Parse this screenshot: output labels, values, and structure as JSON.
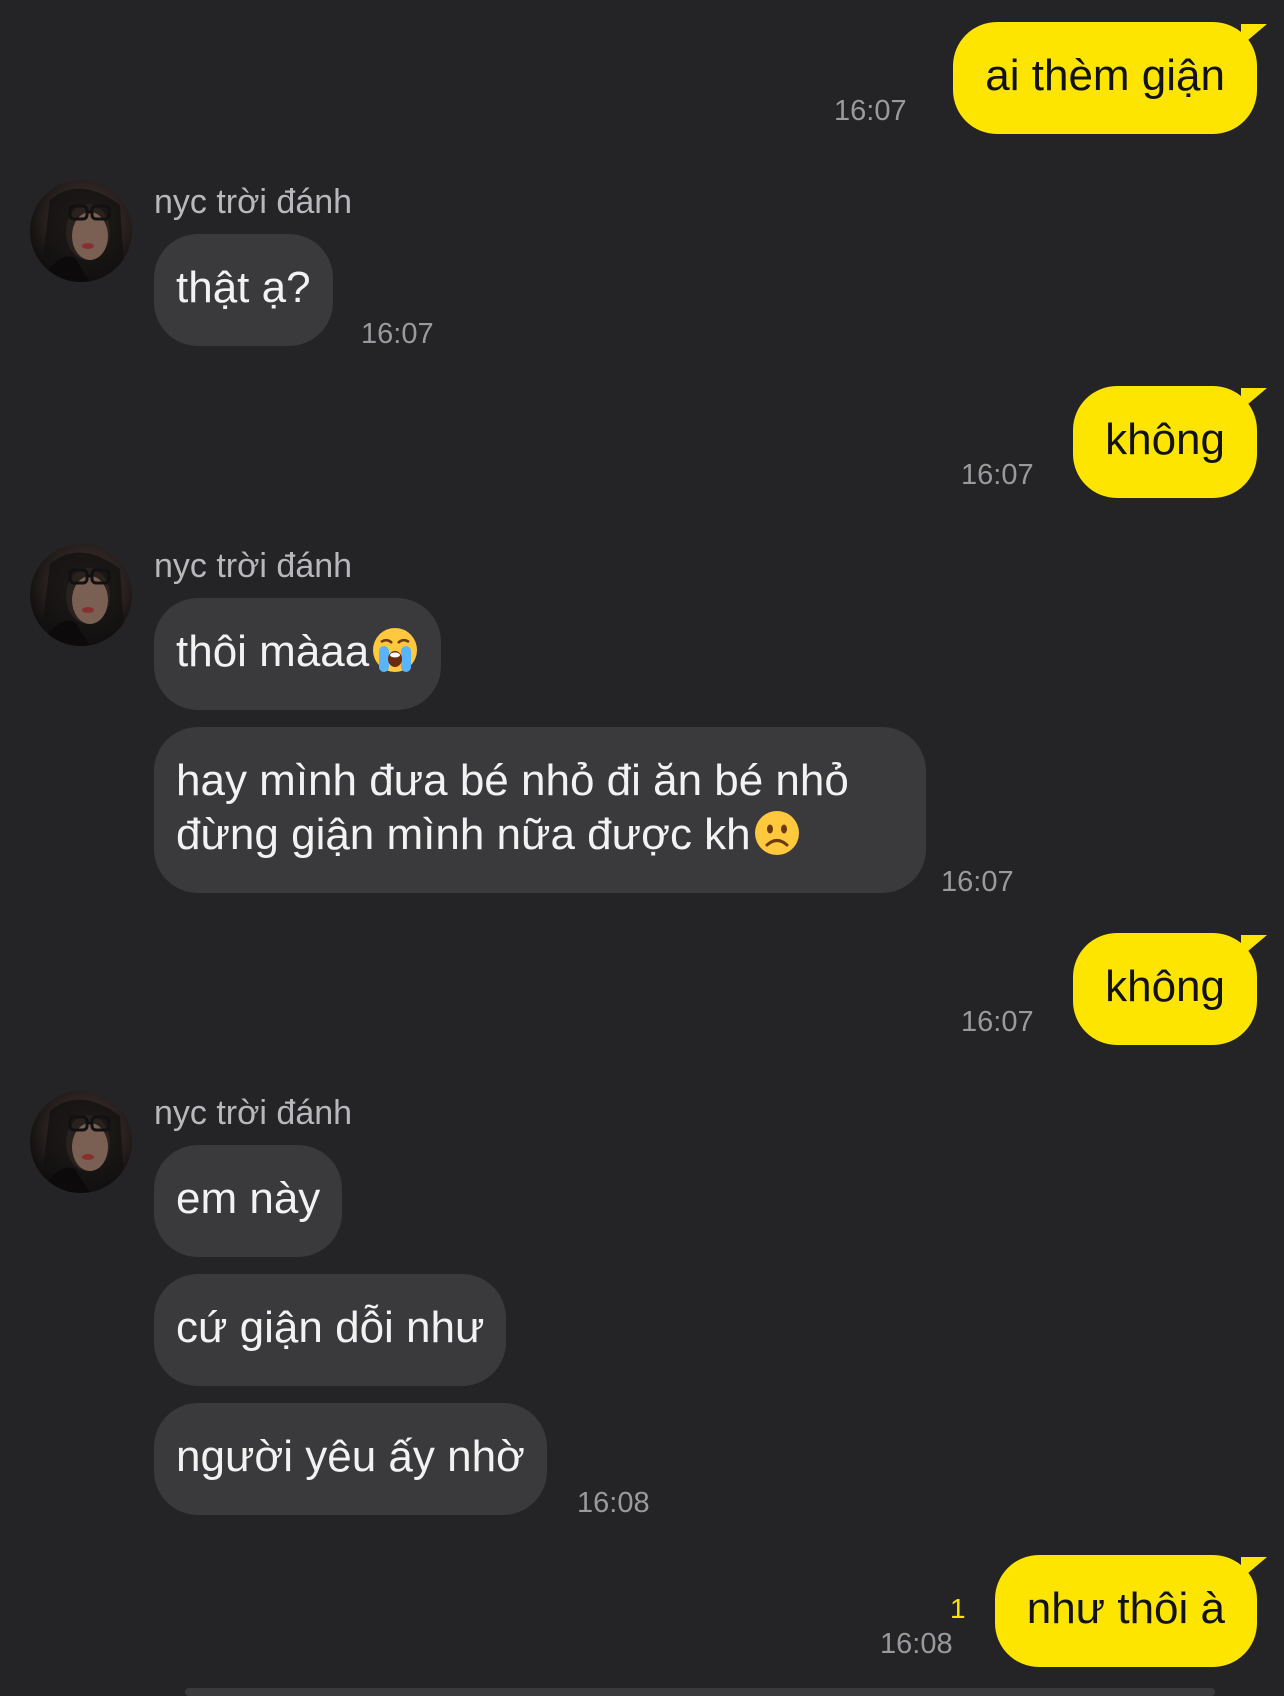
{
  "chat": {
    "sender_name": "nyc trời đánh",
    "unread_count": "1",
    "messages": [
      {
        "from": "me",
        "text": "ai thèm giận",
        "time": "16:07"
      },
      {
        "from": "them",
        "text": "thật ạ?",
        "time": "16:07"
      },
      {
        "from": "me",
        "text": "không",
        "time": "16:07"
      },
      {
        "from": "them",
        "text": "thôi màaa",
        "emoji": "loudly-crying-face"
      },
      {
        "from": "them",
        "text": "hay mình đưa bé nhỏ đi ăn bé nhỏ đừng giận mình nữa được kh",
        "emoji": "frowning-face",
        "time": "16:07"
      },
      {
        "from": "me",
        "text": "không",
        "time": "16:07"
      },
      {
        "from": "them",
        "text": "em này"
      },
      {
        "from": "them",
        "text": "cứ giận dỗi như"
      },
      {
        "from": "them",
        "text": "người yêu ấy nhờ",
        "time": "16:08"
      },
      {
        "from": "me",
        "text": "như thôi à",
        "time": "16:08"
      }
    ]
  },
  "colors": {
    "background": "#242426",
    "my_bubble": "#fee500",
    "their_bubble": "#3a3a3c",
    "timestamp": "#9a9a9e",
    "unread": "#fee500"
  }
}
